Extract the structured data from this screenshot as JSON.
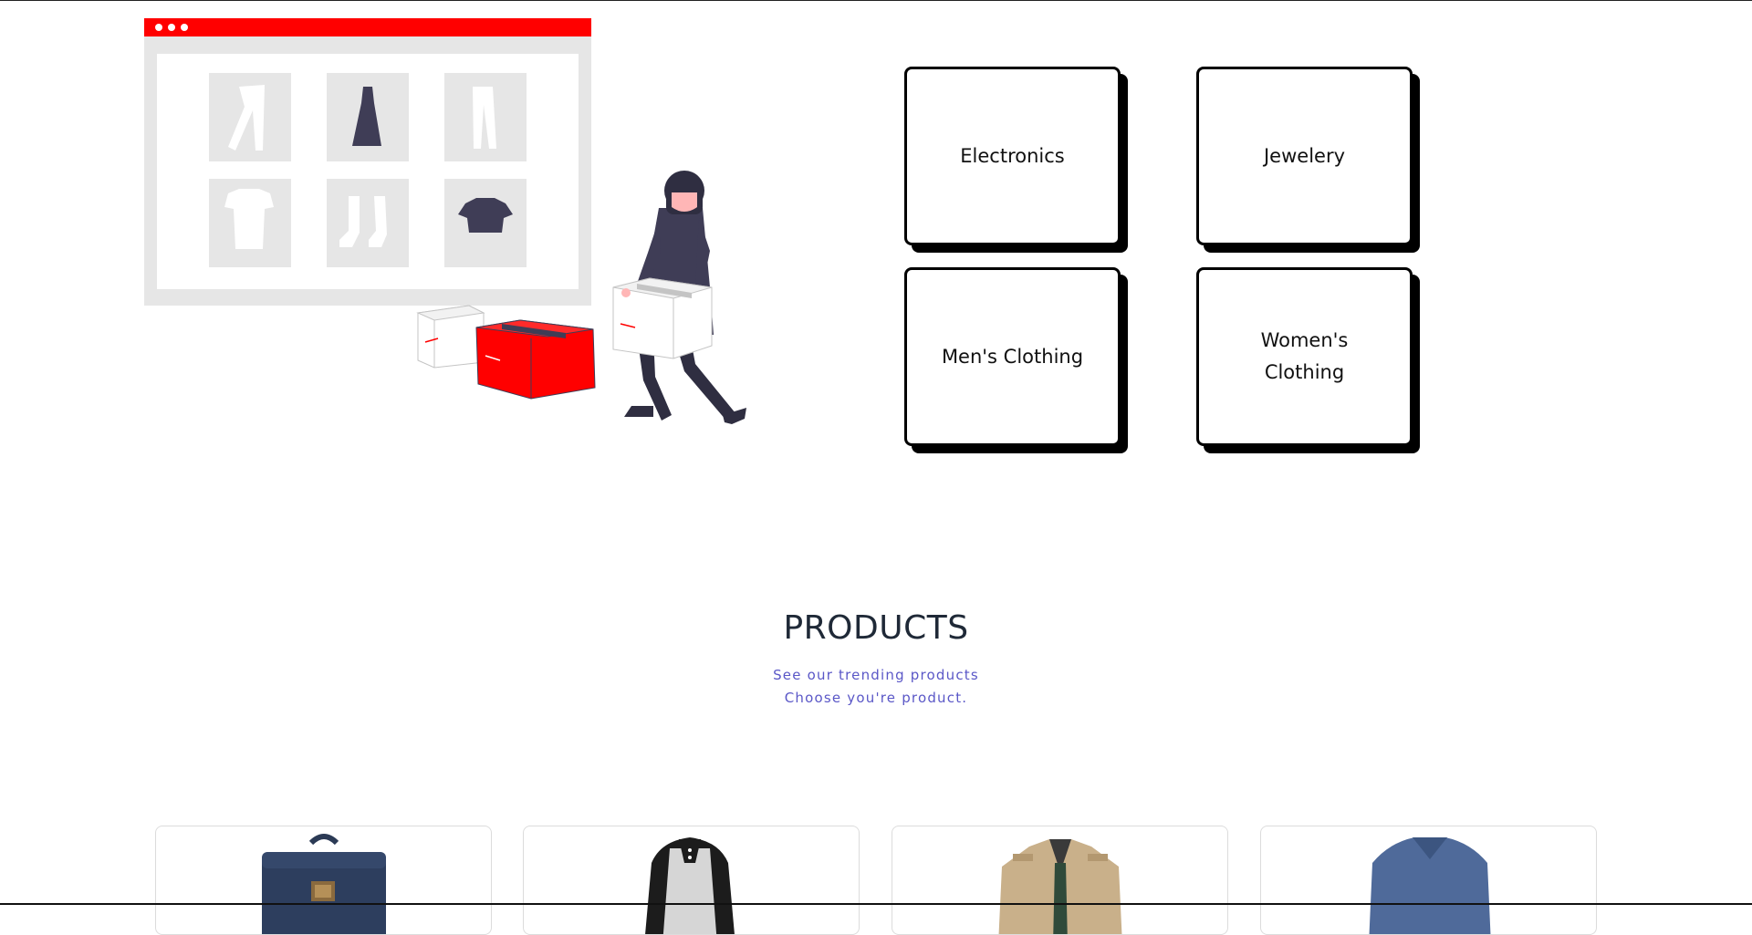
{
  "categories": [
    {
      "label": "Electronics"
    },
    {
      "label": "Jewelery"
    },
    {
      "label": "Men's Clothing"
    },
    {
      "label": "Women's Clothing"
    }
  ],
  "products_section": {
    "title": "PRODUCTS",
    "subtitle_1": "See our trending products",
    "subtitle_2": "Choose you're product."
  },
  "products": [
    {
      "image": "backpack-icon"
    },
    {
      "image": "raglan-shirt-icon"
    },
    {
      "image": "jacket-icon"
    },
    {
      "image": "sweater-icon"
    }
  ],
  "colors": {
    "accent_red": "#ff0000",
    "subtitle_purple": "#5a57c7",
    "figure_dark": "#3f3d56",
    "panel_gray": "#e6e6e6"
  }
}
